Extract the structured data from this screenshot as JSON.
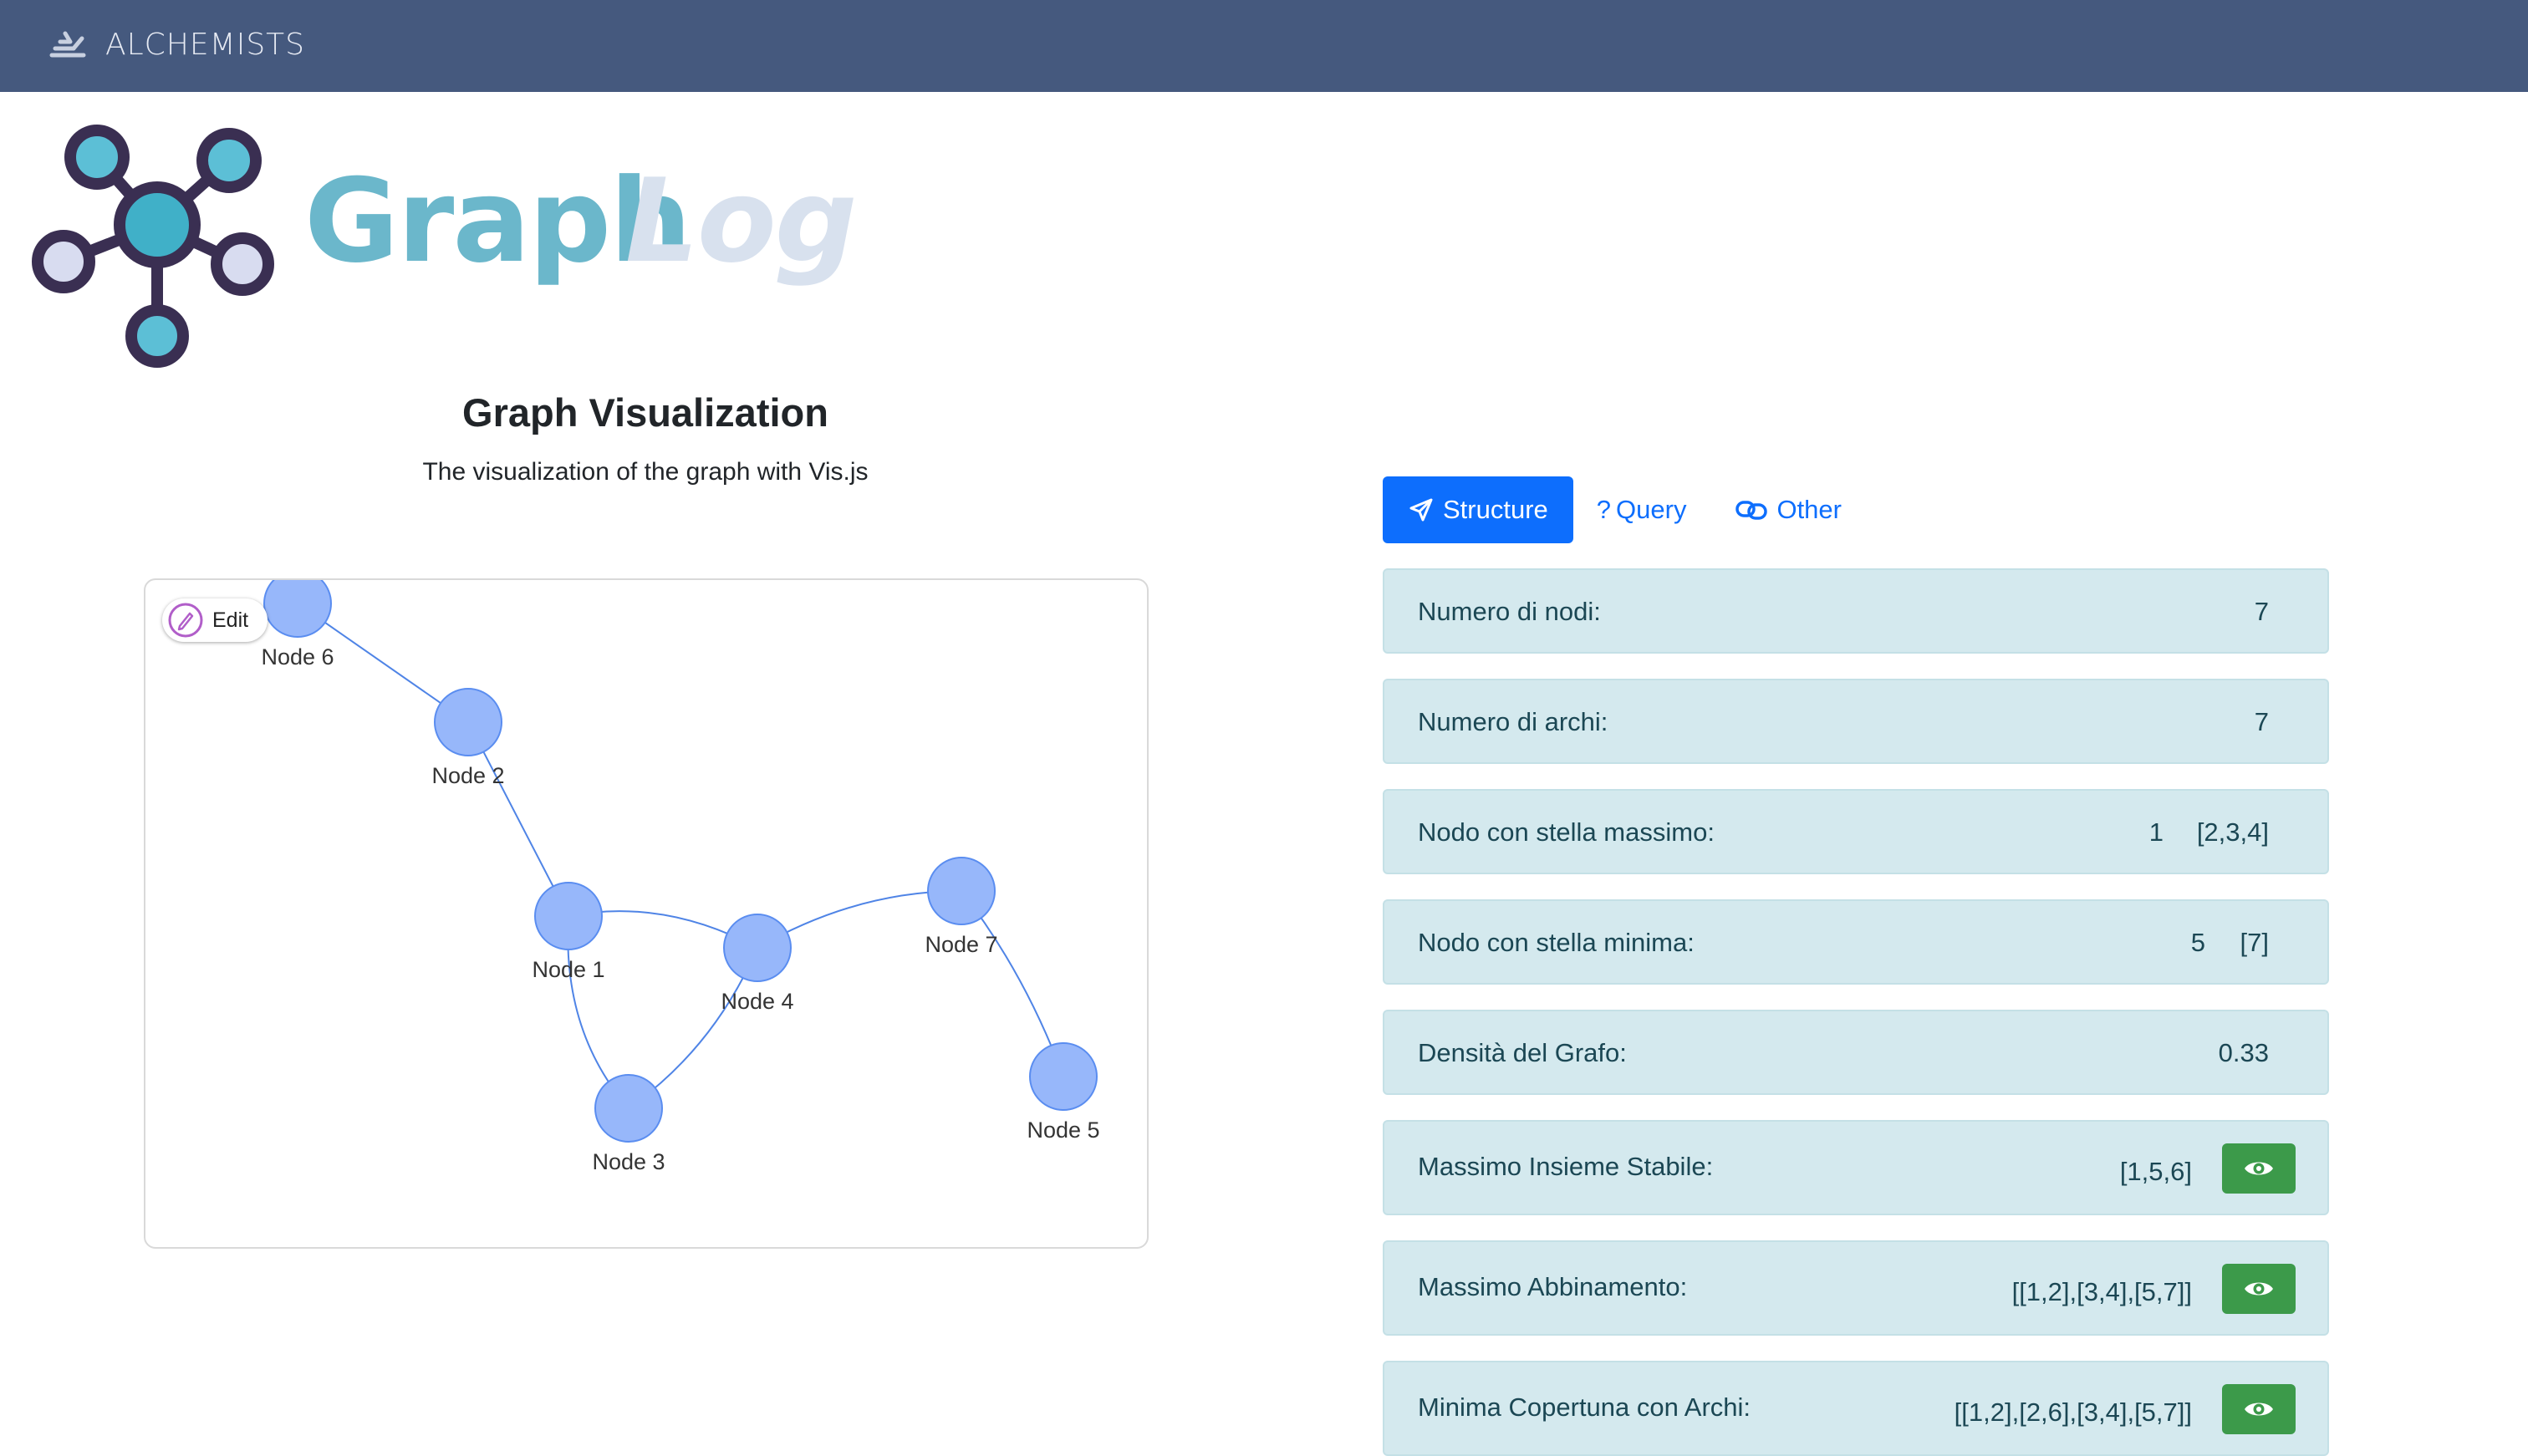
{
  "navbar": {
    "brand": "ALCHEMISTS",
    "bg": "#45597e"
  },
  "logo": {
    "word_main": "Graph",
    "word_accent": "Log",
    "color_main": "#6bb7cb",
    "color_accent": "#d8e1ee",
    "color_outline": "#3a2f52"
  },
  "visualization": {
    "title": "Graph Visualization",
    "subtitle": "The visualization of the graph with Vis.js",
    "edit_label": "Edit",
    "graph": {
      "nodes": [
        {
          "id": 6,
          "label": "Node 6"
        },
        {
          "id": 2,
          "label": "Node 2"
        },
        {
          "id": 1,
          "label": "Node 1"
        },
        {
          "id": 4,
          "label": "Node 4"
        },
        {
          "id": 7,
          "label": "Node 7"
        },
        {
          "id": 3,
          "label": "Node 3"
        },
        {
          "id": 5,
          "label": "Node 5"
        }
      ],
      "edges": [
        [
          6,
          2
        ],
        [
          2,
          1
        ],
        [
          1,
          4
        ],
        [
          1,
          3
        ],
        [
          3,
          4
        ],
        [
          4,
          7
        ],
        [
          7,
          5
        ]
      ],
      "node_color": "#97b7fa",
      "edge_color": "#4f84e6"
    }
  },
  "tabs": [
    {
      "label": "Structure",
      "icon": "send-icon",
      "active": true
    },
    {
      "label": "Query",
      "icon": "question-icon",
      "active": false
    },
    {
      "label": "Other",
      "icon": "link-icon",
      "active": false
    }
  ],
  "stats": {
    "nodes_label": "Numero di nodi:",
    "nodes_value": "7",
    "edges_label": "Numero di archi:",
    "edges_value": "7",
    "max_star_label": "Nodo con stella massimo:",
    "max_star_node": "1",
    "max_star_set": "[2,3,4]",
    "min_star_label": "Nodo con stella minima:",
    "min_star_node": "5",
    "min_star_set": "[7]",
    "density_label": "Densità del Grafo:",
    "density_value": "0.33",
    "stable_label": "Massimo Insieme Stabile:",
    "stable_value": "[1,5,6]",
    "matching_label": "Massimo Abbinamento:",
    "matching_value": "[[1,2],[3,4],[5,7]]",
    "cover_label": "Minima Copertuna con Archi:",
    "cover_value": "[[1,2],[2,6],[3,4],[5,7]]"
  },
  "colors": {
    "primary": "#0d6efd",
    "info_bg": "#d4e9ee",
    "info_text": "#1b4754",
    "success": "#3c9a4a"
  }
}
